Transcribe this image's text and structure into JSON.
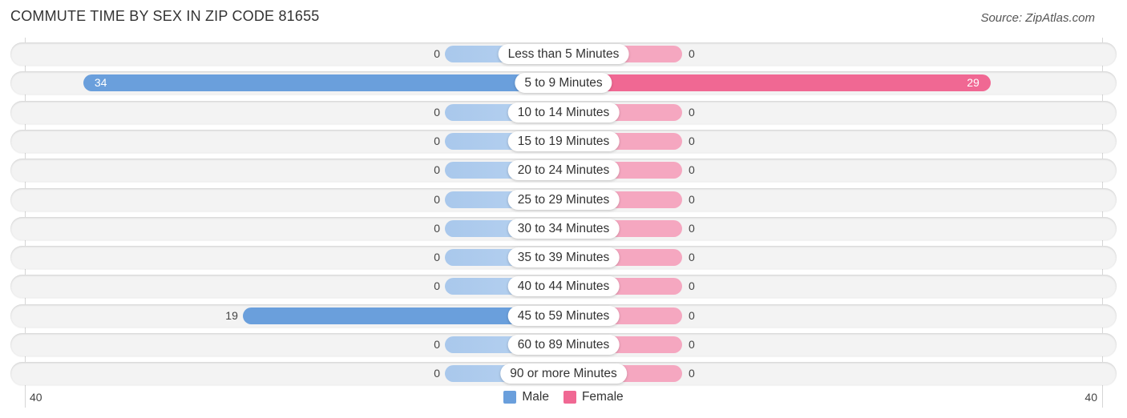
{
  "chart_data": {
    "type": "bar",
    "orientation": "horizontal-diverging",
    "title": "COMMUTE TIME BY SEX IN ZIP CODE 81655",
    "source": "Source: ZipAtlas.com",
    "categories": [
      "Less than 5 Minutes",
      "5 to 9 Minutes",
      "10 to 14 Minutes",
      "15 to 19 Minutes",
      "20 to 24 Minutes",
      "25 to 29 Minutes",
      "30 to 34 Minutes",
      "35 to 39 Minutes",
      "40 to 44 Minutes",
      "45 to 59 Minutes",
      "60 to 89 Minutes",
      "90 or more Minutes"
    ],
    "series": [
      {
        "name": "Male",
        "color": "#6a9fdc",
        "zero_color": "#a9c8ec",
        "values": [
          0,
          34,
          0,
          0,
          0,
          0,
          0,
          0,
          0,
          19,
          0,
          0
        ]
      },
      {
        "name": "Female",
        "color": "#f06893",
        "zero_color": "#f5a7c0",
        "values": [
          0,
          29,
          0,
          0,
          0,
          0,
          0,
          0,
          0,
          0,
          0,
          0
        ]
      }
    ],
    "axis": {
      "left_label": "40",
      "right_label": "40",
      "range": [
        -40,
        40
      ]
    },
    "legend": {
      "position": "bottom-center",
      "items": [
        "Male",
        "Female"
      ]
    },
    "grid": true
  }
}
